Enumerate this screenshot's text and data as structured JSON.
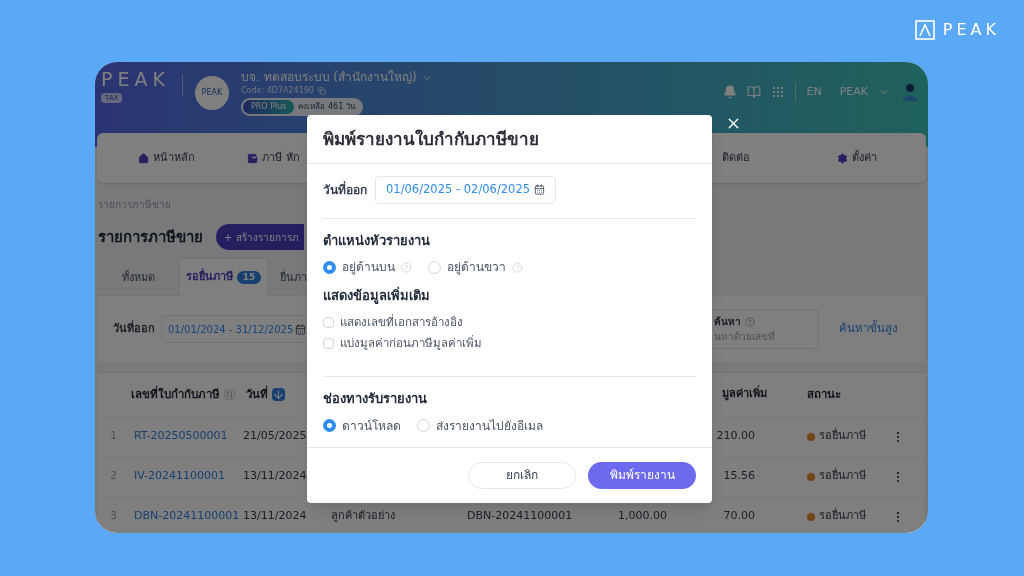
{
  "brand": {
    "name": "PEAK"
  },
  "header": {
    "logo": "PEAK",
    "logo_badge": "TAX",
    "company_logo": "PEAK",
    "company": "บจ. ทดสอบระบบ (สำนักงานใหญ่)",
    "code": "Code: 4D7A24190",
    "plan": "PRO Plus",
    "remaining": "คงเหลือ 461 วัน",
    "language": "EN",
    "user": "PEAK"
  },
  "nav": [
    {
      "label": "หน้าหลัก"
    },
    {
      "label": "ภาษี หัก"
    },
    {
      "label": "ติดต่อ"
    },
    {
      "label": "ตั้งค่า"
    }
  ],
  "breadcrumb": "รายการภาษีขาย",
  "page_title": "รายการภาษีขาย",
  "create_button": "+ สร้างรายการภ",
  "tabs": [
    {
      "label": "ทั้งหมด",
      "selected": false
    },
    {
      "label": "รอยื่นภาษี",
      "badge": "15",
      "selected": true
    },
    {
      "label": "ยื่นภา",
      "selected": false
    }
  ],
  "filter": {
    "date_label": "วันที่ออก",
    "date_value": "01/01/2024 - 31/12/2025",
    "search_label": "ค้นหา",
    "search_placeholder": "นหาด้วยเลขที่",
    "advanced_link": "ค้นหาขั้นสูง"
  },
  "table": {
    "columns": [
      "เลขที่ใบกำกับภาษี",
      "วันที่",
      "มูลค่าเพิ่ม",
      "สถานะ"
    ],
    "rows": [
      {
        "index": "1",
        "number": "RT-20250500001",
        "date": "21/05/2025",
        "vat": "210.00",
        "status": "รอยื่นภาษี"
      },
      {
        "index": "2",
        "number": "IV-20241100001",
        "date": "13/11/2024",
        "vat": "15.56",
        "status": "รอยื่นภาษี"
      },
      {
        "index": "3",
        "number": "DBN-20241100001",
        "date": "13/11/2024",
        "customer": "ลูกค้าตัวอย่าง",
        "reference": "DBN-20241100001",
        "amount": "1,000.00",
        "vat": "70.00",
        "status": "รอยื่นภาษี"
      }
    ]
  },
  "dialog": {
    "title": "พิมพ์รายงานใบกำกับภาษีขาย",
    "date_label": "วันที่ออก",
    "date_value": "01/06/2025 - 02/06/2025",
    "header_position": {
      "title": "ตำแหน่งหัวรายงาน",
      "options": [
        {
          "label": "อยู่ด้านบน",
          "selected": true
        },
        {
          "label": "อยู่ด้านขวา",
          "selected": false
        }
      ]
    },
    "extra_info": {
      "title": "แสดงข้อมูลเพิ่มเติม",
      "options": [
        {
          "label": "แสดงเลขที่เอกสารอ้างอิง",
          "checked": false
        },
        {
          "label": "แบ่งมูลค่าก่อนภาษีมูลค่าเพิ่ม",
          "checked": false
        }
      ]
    },
    "delivery": {
      "title": "ช่องทางรับรายงาน",
      "options": [
        {
          "label": "ดาวน์โหลด",
          "selected": true
        },
        {
          "label": "ส่งรายงานไปยังอีเมล",
          "selected": false
        }
      ]
    },
    "buttons": [
      {
        "label": "ยกเลิก",
        "kind": "secondary"
      },
      {
        "label": "พิมพ์รายงาน",
        "kind": "primary"
      }
    ]
  }
}
